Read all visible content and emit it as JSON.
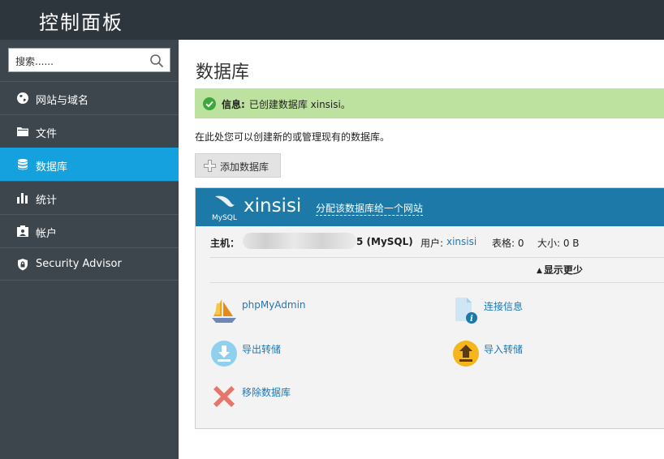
{
  "header": {
    "title": "控制面板"
  },
  "sidebar": {
    "search": {
      "placeholder": "搜索......"
    },
    "items": [
      {
        "label": "网站与域名",
        "icon": "globe-icon"
      },
      {
        "label": "文件",
        "icon": "folder-icon"
      },
      {
        "label": "数据库",
        "icon": "database-icon",
        "active": true
      },
      {
        "label": "统计",
        "icon": "bar-chart-icon"
      },
      {
        "label": "帐户",
        "icon": "account-icon"
      },
      {
        "label": "Security Advisor",
        "icon": "shield-lock-icon"
      }
    ]
  },
  "main": {
    "title": "数据库",
    "message": {
      "label": "信息:",
      "text": "已创建数据库 xinsisi。"
    },
    "intro": "在此处您可以创建新的或管理现有的数据库。",
    "add_button": "添加数据库",
    "database": {
      "name": "xinsisi",
      "assign_link": "分配该数据库给一个网站",
      "host_label": "主机：",
      "host_suffix": "5 (MySQL)",
      "user_label": "用户:",
      "user_value": "xinsisi",
      "tables_text": "表格: 0",
      "size_text": "大小: 0 B",
      "toggle": "显示更少",
      "tools": [
        {
          "label": "phpMyAdmin",
          "icon": "phpmyadmin-sailboat-icon"
        },
        {
          "label": "连接信息",
          "icon": "connection-info-icon"
        },
        {
          "label": "导出转储",
          "icon": "export-dump-icon"
        },
        {
          "label": "导入转储",
          "icon": "import-dump-icon"
        },
        {
          "label": "移除数据库",
          "icon": "remove-database-icon"
        }
      ]
    }
  },
  "colors": {
    "sidebar_bg": "#3d464d",
    "active_item": "#14a1dd",
    "db_header": "#1c79a8",
    "success_bg": "#bde19e",
    "link": "#1f77b4"
  }
}
